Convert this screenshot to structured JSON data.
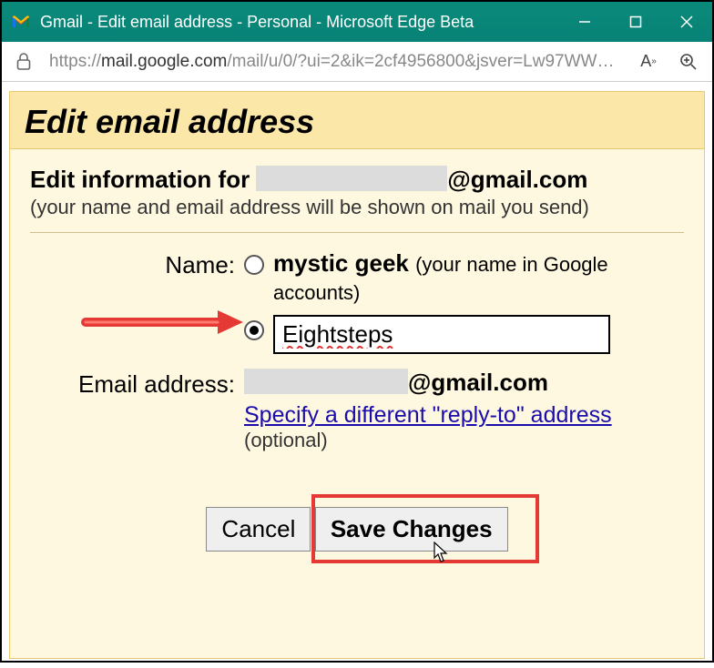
{
  "window": {
    "title": "Gmail - Edit email address - Personal - Microsoft Edge Beta"
  },
  "addressbar": {
    "url_prefix": "https://",
    "url_host": "mail.google.com",
    "url_path": "/mail/u/0/?ui=2&ik=2cf4956800&jsver=Lw97WWzjqrU..."
  },
  "panel": {
    "title": "Edit email address",
    "info_prefix": "Edit information for ",
    "info_suffix": "@gmail.com",
    "subtext": "(your name and email address will be shown on mail you send)",
    "name_label": "Name:",
    "email_label": "Email address:",
    "google_name": "mystic geek",
    "google_name_hint": "(your name in Google accounts)",
    "custom_name_value": "Eightsteps",
    "email_suffix": "@gmail.com",
    "reply_to_link": "Specify a different \"reply-to\" address",
    "optional": "(optional)",
    "cancel": "Cancel",
    "save": "Save Changes"
  }
}
